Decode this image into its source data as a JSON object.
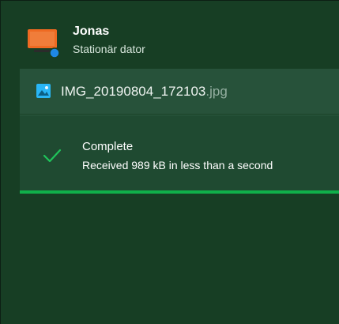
{
  "colors": {
    "background": "#173e24",
    "accent": "#10b04a",
    "check": "#1fc45a",
    "device_icon": "#ef6a22",
    "badge": "#1e88e5",
    "file_icon": "#29b6f6"
  },
  "device": {
    "icon": "desktop-computer-icon",
    "name": "Jonas",
    "type": "Stationär dator"
  },
  "file": {
    "icon": "image-icon",
    "base_name": "IMG_20190804_172103",
    "extension": ".jpg"
  },
  "status": {
    "icon": "checkmark-icon",
    "title": "Complete",
    "detail": "Received 989 kB in less than a second"
  },
  "progress": {
    "fraction": 1.0
  }
}
